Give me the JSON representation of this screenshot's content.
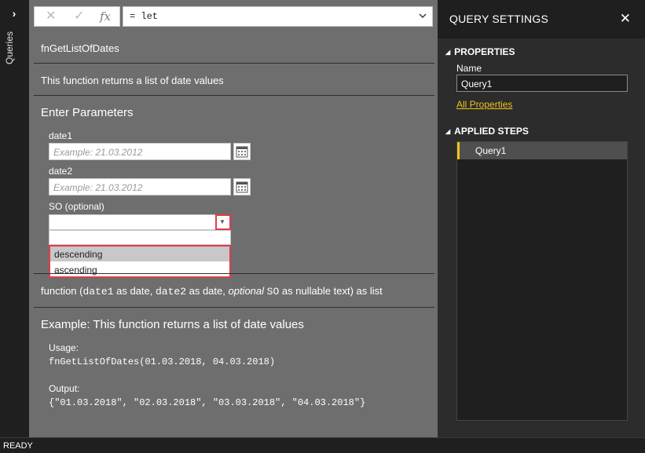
{
  "rail": {
    "queries_label": "Queries",
    "expand_icon": "chevron-right-icon"
  },
  "formula_bar": {
    "cancel_icon": "close-icon",
    "commit_icon": "checkmark-icon",
    "fx_label": "fx",
    "formula": "= let"
  },
  "function": {
    "name": "fnGetListOfDates",
    "description": "This function returns a list of date values",
    "enter_params_title": "Enter Parameters",
    "params": [
      {
        "label": "date1",
        "placeholder": "Example: 21.03.2012"
      },
      {
        "label": "date2",
        "placeholder": "Example: 21.03.2012"
      }
    ],
    "so_label": "SO (optional)",
    "so_value": "",
    "so_options": [
      "descending",
      "ascending"
    ],
    "signature": {
      "prefix": "function (",
      "p1": "date1",
      "t1": " as date, ",
      "p2": "date2",
      "t2": " as date, ",
      "optional": "optional",
      "space": " ",
      "p3": "SO",
      "t3": " as nullable text) as list"
    },
    "example_title": "Example: This function returns a list of date values",
    "usage_label": "Usage:",
    "usage_code": "fnGetListOfDates(01.03.2018, 04.03.2018)",
    "output_label": "Output:",
    "output_code": "{\"01.03.2018\", \"02.03.2018\", \"03.03.2018\", \"04.03.2018\"}"
  },
  "settings": {
    "title": "QUERY SETTINGS",
    "properties_header": "PROPERTIES",
    "name_label": "Name",
    "name_value": "Query1",
    "all_properties_link": "All Properties",
    "applied_steps_header": "APPLIED STEPS",
    "steps": [
      "Query1"
    ]
  },
  "status": {
    "text": "READY"
  },
  "colors": {
    "accent_yellow": "#f0c419",
    "highlight_red": "#e03c4b"
  }
}
